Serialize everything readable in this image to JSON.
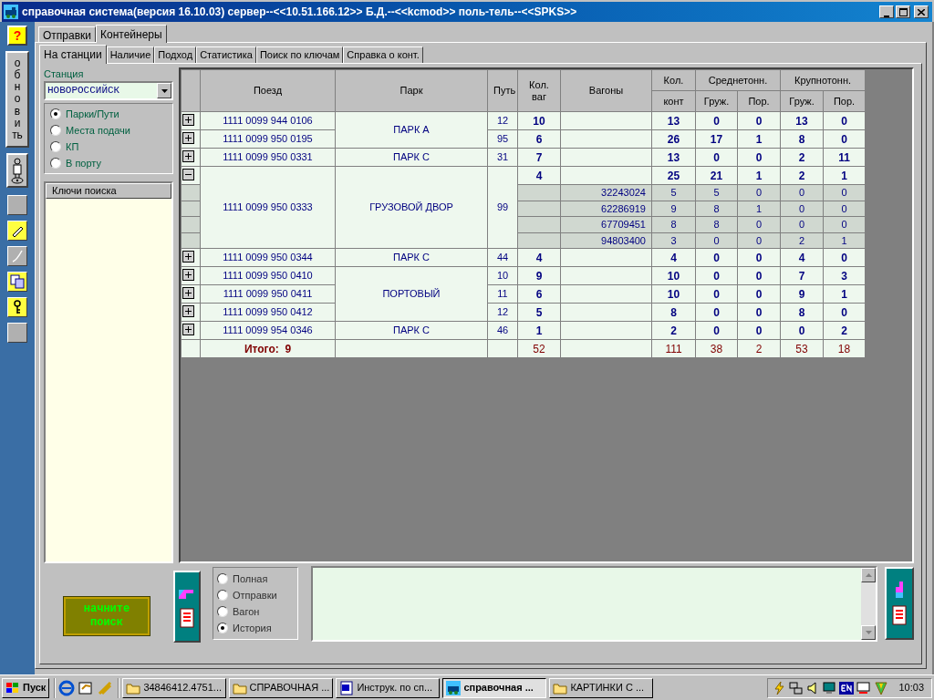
{
  "window": {
    "title": "справочная система(версия 16.10.03) сервер--<<10.51.166.12>> Б.Д.--<<kcmod>> поль-тель--<<SPKS>>"
  },
  "toolbar": {
    "help": "?",
    "refresh": "обновить"
  },
  "tabs": [
    {
      "label": "Отправки",
      "selected": false
    },
    {
      "label": "Контейнеры",
      "selected": true
    }
  ],
  "subtabs": [
    {
      "label": "На станции",
      "selected": true
    },
    {
      "label": "Наличие",
      "selected": false
    },
    {
      "label": "Подход",
      "selected": false
    },
    {
      "label": "Статистика",
      "selected": false
    },
    {
      "label": "Поиск по ключам",
      "selected": false
    },
    {
      "label": "Справка о конт.",
      "selected": false
    }
  ],
  "station": {
    "label": "Станция",
    "value": "НОВОРОССИЙСК"
  },
  "view_options": [
    {
      "label": "Парки/Пути",
      "selected": true
    },
    {
      "label": "Места подачи",
      "selected": false
    },
    {
      "label": "КП",
      "selected": false
    },
    {
      "label": "В порту",
      "selected": false
    }
  ],
  "search_keys": {
    "header": "Ключи поиска"
  },
  "table": {
    "columns": [
      {
        "label": "Поезд"
      },
      {
        "label": "Парк"
      },
      {
        "label": "Путь"
      },
      {
        "label": "Кол. ваг"
      },
      {
        "label": "Вагоны"
      },
      {
        "label": "Кол.",
        "sub": [
          "конт"
        ]
      },
      {
        "label": "Среднетонн.",
        "sub": [
          "Груж.",
          "Пор."
        ]
      },
      {
        "label": "Крупнотонн.",
        "sub": [
          "Груж.",
          "Пор."
        ]
      }
    ],
    "groups": [
      {
        "park": "ПАРК А",
        "trains": [
          {
            "train": "1111 0099 944 0106",
            "expanded": false,
            "track": "12",
            "wagons": "10",
            "values": [
              "13",
              "0",
              "0",
              "13",
              "0"
            ]
          },
          {
            "train": "1111 0099 950 0195",
            "expanded": false,
            "track": "95",
            "wagons": "6",
            "values": [
              "26",
              "17",
              "1",
              "8",
              "0"
            ]
          }
        ]
      },
      {
        "park": "ПАРК С",
        "trains": [
          {
            "train": "1111 0099 950 0331",
            "expanded": false,
            "track": "31",
            "wagons": "7",
            "values": [
              "13",
              "0",
              "0",
              "2",
              "11"
            ]
          }
        ]
      },
      {
        "park": "ГРУЗОВОЙ ДВОР",
        "trains": [
          {
            "train": "1111 0099 950 0333",
            "expanded": true,
            "track": "99",
            "wagons": "4",
            "values": [
              "25",
              "21",
              "1",
              "2",
              "1"
            ],
            "wagon_rows": [
              {
                "number": "32243024",
                "values": [
                  "5",
                  "5",
                  "0",
                  "0",
                  "0"
                ]
              },
              {
                "number": "62286919",
                "values": [
                  "9",
                  "8",
                  "1",
                  "0",
                  "0"
                ]
              },
              {
                "number": "67709451",
                "values": [
                  "8",
                  "8",
                  "0",
                  "0",
                  "0"
                ]
              },
              {
                "number": "94803400",
                "values": [
                  "3",
                  "0",
                  "0",
                  "2",
                  "1"
                ]
              }
            ]
          }
        ]
      },
      {
        "park": "ПАРК С",
        "trains": [
          {
            "train": "1111 0099 950 0344",
            "expanded": false,
            "track": "44",
            "wagons": "4",
            "values": [
              "4",
              "0",
              "0",
              "4",
              "0"
            ]
          }
        ]
      },
      {
        "park": "ПОРТОВЫЙ",
        "trains": [
          {
            "train": "1111 0099 950 0410",
            "expanded": false,
            "track": "10",
            "wagons": "9",
            "values": [
              "10",
              "0",
              "0",
              "7",
              "3"
            ]
          },
          {
            "train": "1111 0099 950 0411",
            "expanded": false,
            "track": "11",
            "wagons": "6",
            "values": [
              "10",
              "0",
              "0",
              "9",
              "1"
            ]
          },
          {
            "train": "1111 0099 950 0412",
            "expanded": false,
            "track": "12",
            "wagons": "5",
            "values": [
              "8",
              "0",
              "0",
              "8",
              "0"
            ]
          }
        ]
      },
      {
        "park": "ПАРК С",
        "trains": [
          {
            "train": "1111 0099 954 0346",
            "expanded": false,
            "track": "46",
            "wagons": "1",
            "values": [
              "2",
              "0",
              "0",
              "0",
              "2"
            ]
          }
        ]
      }
    ],
    "total": {
      "label": "Итого:  9",
      "wagons": "52",
      "values": [
        "111",
        "38",
        "2",
        "53",
        "18"
      ]
    }
  },
  "search_button": "начните поиск",
  "report_options": [
    {
      "label": "Полная",
      "selected": false
    },
    {
      "label": "Отправки",
      "selected": false
    },
    {
      "label": "Вагон",
      "selected": false
    },
    {
      "label": "История",
      "selected": true
    }
  ],
  "taskbar": {
    "start": "Пуск",
    "tasks": [
      {
        "label": "34846412.4751...",
        "kind": "folder",
        "selected": false
      },
      {
        "label": "СПРАВОЧНАЯ ...",
        "kind": "folder",
        "selected": false
      },
      {
        "label": "Инструк. по сп...",
        "kind": "document",
        "selected": false
      },
      {
        "label": "справочная ...",
        "kind": "app",
        "selected": true
      },
      {
        "label": "КАРТИНКИ С ...",
        "kind": "folder",
        "selected": false
      }
    ],
    "clock": "10:03"
  }
}
